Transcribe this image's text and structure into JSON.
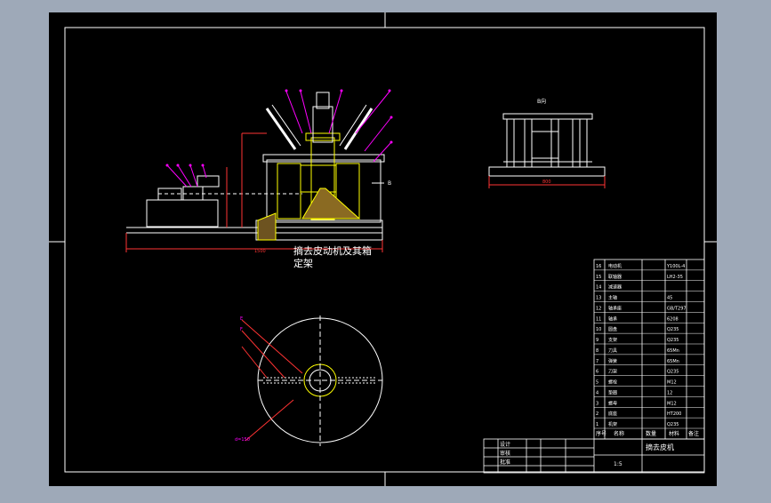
{
  "drawing": {
    "view_label_b": "B向",
    "section_mark": "B",
    "title_line1": "摘去皮动机及其箱",
    "title_line2": "定架",
    "dim_main": "1500",
    "dim_b_view": "800",
    "dim_bottom_left": "d=150",
    "label_e": "E",
    "label_f": "F"
  },
  "colors": {
    "background": "#9ea9b8",
    "sheet": "#000000",
    "line": "#ffffff",
    "accent": "#ff00ff",
    "highlight": "#ffff00",
    "red": "#ff3333"
  },
  "title_block": {
    "parts_rows": [
      {
        "no": "16",
        "name": "电动机",
        "spec": "Y100L-4"
      },
      {
        "no": "15",
        "name": "联轴器",
        "spec": "LH2-35"
      },
      {
        "no": "14",
        "name": "减速器",
        "spec": ""
      },
      {
        "no": "13",
        "name": "主轴",
        "spec": "45"
      },
      {
        "no": "12",
        "name": "轴承座",
        "spec": "GB/T297"
      },
      {
        "no": "11",
        "name": "轴承",
        "spec": "6208"
      },
      {
        "no": "10",
        "name": "圆盘",
        "spec": "Q235"
      },
      {
        "no": "9",
        "name": "支架",
        "spec": "Q235"
      },
      {
        "no": "8",
        "name": "刀具",
        "spec": "65Mn"
      },
      {
        "no": "7",
        "name": "弹簧",
        "spec": "65Mn"
      },
      {
        "no": "6",
        "name": "刀架",
        "spec": "Q235"
      },
      {
        "no": "5",
        "name": "螺栓",
        "spec": "M12"
      },
      {
        "no": "4",
        "name": "垫圈",
        "spec": "12"
      },
      {
        "no": "3",
        "name": "螺母",
        "spec": "M12"
      },
      {
        "no": "2",
        "name": "底座",
        "spec": "HT200"
      },
      {
        "no": "1",
        "name": "机架",
        "spec": "Q235"
      }
    ],
    "header": [
      "序号",
      "名称",
      "数量",
      "材料",
      "备注"
    ],
    "bottom_rows": [
      "设计",
      "审核",
      "批准"
    ],
    "drawing_name": "摘去皮机",
    "scale": "1:5"
  }
}
